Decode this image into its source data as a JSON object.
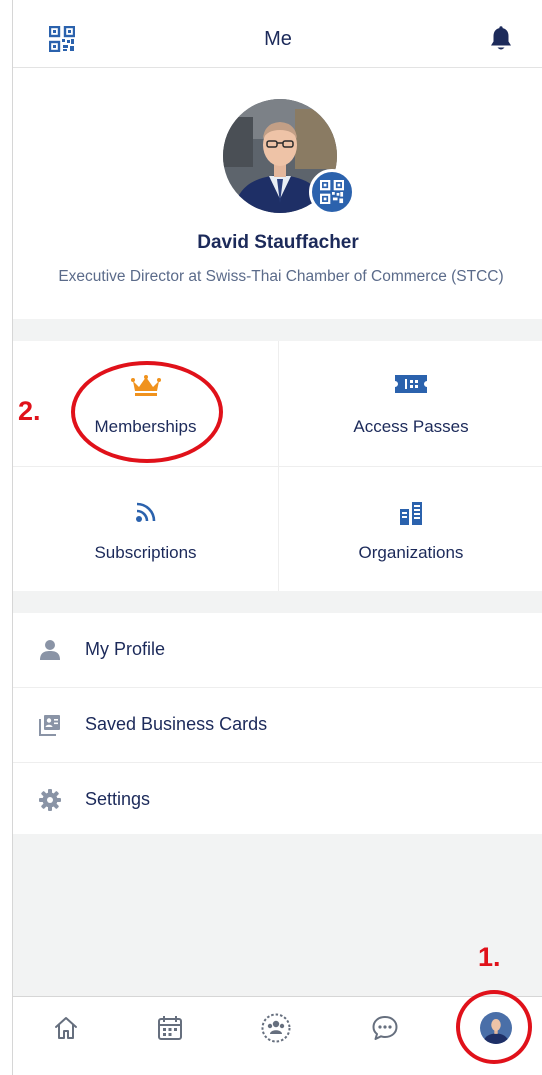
{
  "header": {
    "title": "Me",
    "left_icon": "qr-code-icon",
    "right_icon": "bell-icon"
  },
  "profile": {
    "name": "David Stauffacher",
    "subtitle": "Executive Director at Swiss-Thai Chamber of Commerce (STCC)",
    "badge_icon": "qr-code-icon"
  },
  "grid": [
    {
      "label": "Memberships",
      "icon": "crown-icon",
      "color": "#f0921d"
    },
    {
      "label": "Access Passes",
      "icon": "ticket-icon",
      "color": "#2b62ad"
    },
    {
      "label": "Subscriptions",
      "icon": "rss-icon",
      "color": "#2b62ad"
    },
    {
      "label": "Organizations",
      "icon": "buildings-icon",
      "color": "#2b62ad"
    }
  ],
  "menu": [
    {
      "label": "My Profile",
      "icon": "person-icon"
    },
    {
      "label": "Saved Business Cards",
      "icon": "business-card-icon"
    },
    {
      "label": "Settings",
      "icon": "gear-icon"
    }
  ],
  "tabs": [
    {
      "icon": "home-icon"
    },
    {
      "icon": "calendar-icon"
    },
    {
      "icon": "community-icon"
    },
    {
      "icon": "chat-icon"
    },
    {
      "icon": "profile-avatar-icon",
      "active": true
    }
  ],
  "annotations": {
    "step1": "1.",
    "step2": "2.",
    "color": "#e0111a"
  },
  "colors": {
    "primary": "#1c2a5a",
    "accent_blue": "#2b62ad",
    "accent_orange": "#f0921d",
    "muted_text": "#5b6b8a",
    "icon_gray": "#8a94a6",
    "separator": "#f2f3f3"
  }
}
